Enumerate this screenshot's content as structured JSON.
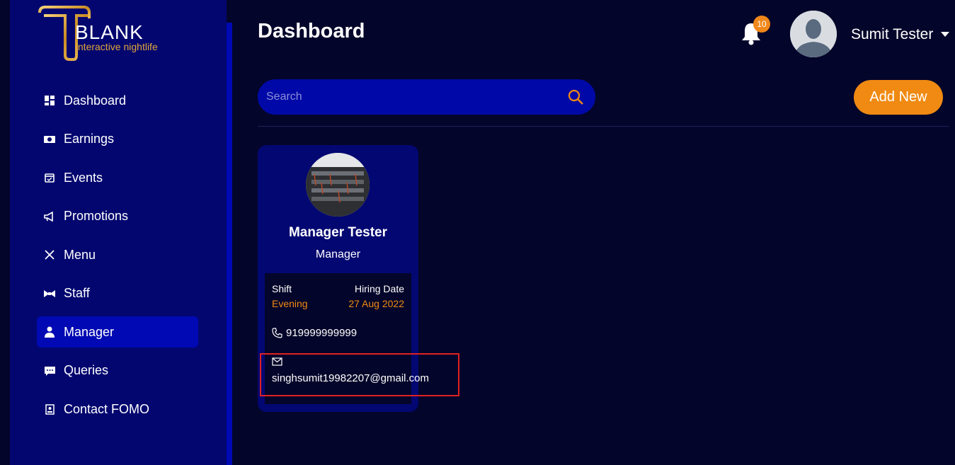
{
  "brand": {
    "title": "BLANK",
    "subtitle": "Interactive nightlife"
  },
  "sidebar": {
    "items": [
      {
        "label": "Dashboard",
        "icon": "dashboard-icon",
        "active": false
      },
      {
        "label": "Earnings",
        "icon": "money-icon",
        "active": false
      },
      {
        "label": "Events",
        "icon": "calendar-icon",
        "active": false
      },
      {
        "label": "Promotions",
        "icon": "megaphone-icon",
        "active": false
      },
      {
        "label": "Menu",
        "icon": "utensils-icon",
        "active": false
      },
      {
        "label": "Staff",
        "icon": "bowtie-icon",
        "active": false
      },
      {
        "label": "Manager",
        "icon": "user-tie-icon",
        "active": true
      },
      {
        "label": "Queries",
        "icon": "chat-icon",
        "active": false
      },
      {
        "label": "Contact FOMO",
        "icon": "contact-card-icon",
        "active": false
      }
    ]
  },
  "header": {
    "title": "Dashboard",
    "notification_count": "10",
    "user_name": "Sumit Tester"
  },
  "toolbar": {
    "search_placeholder": "Search",
    "add_label": "Add New"
  },
  "card": {
    "name": "Manager Tester",
    "role": "Manager",
    "shift_label": "Shift",
    "shift_value": "Evening",
    "hiring_label": "Hiring Date",
    "hiring_value": "27 Aug 2022",
    "phone": "919999999999",
    "email": "singhsumit19982207@gmail.com"
  },
  "colors": {
    "background": "#04052a",
    "sidebar": "#03066f",
    "accent": "#f08a12",
    "active_item": "#0009b3"
  }
}
